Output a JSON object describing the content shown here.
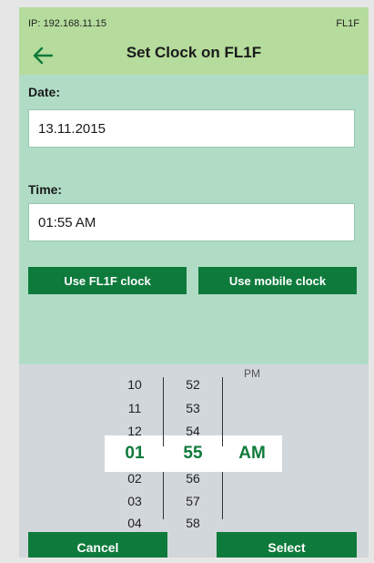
{
  "status": {
    "ip": "IP: 192.168.11.15",
    "device": "FL1F"
  },
  "header": {
    "title": "Set Clock on FL1F"
  },
  "form": {
    "date_label": "Date:",
    "date_value": "13.11.2015",
    "time_label": "Time:",
    "time_value": "01:55 AM",
    "use_device_clock": "Use FL1F clock",
    "use_mobile_clock": "Use mobile clock"
  },
  "picker": {
    "hours_above": [
      "10",
      "11",
      "12"
    ],
    "hour_selected": "01",
    "hours_below": [
      "02",
      "03",
      "04"
    ],
    "minutes_above": [
      "52",
      "53",
      "54"
    ],
    "minute_selected": "55",
    "minutes_below": [
      "56",
      "57",
      "58"
    ],
    "ampm_above": "PM",
    "ampm_selected": "AM"
  },
  "actions": {
    "cancel": "Cancel",
    "select": "Select"
  },
  "colors": {
    "header_bg": "#b5dc9c",
    "content_bg": "#b0dcc6",
    "accent": "#0e7a3b",
    "picker_bg": "#d2d7dc"
  }
}
